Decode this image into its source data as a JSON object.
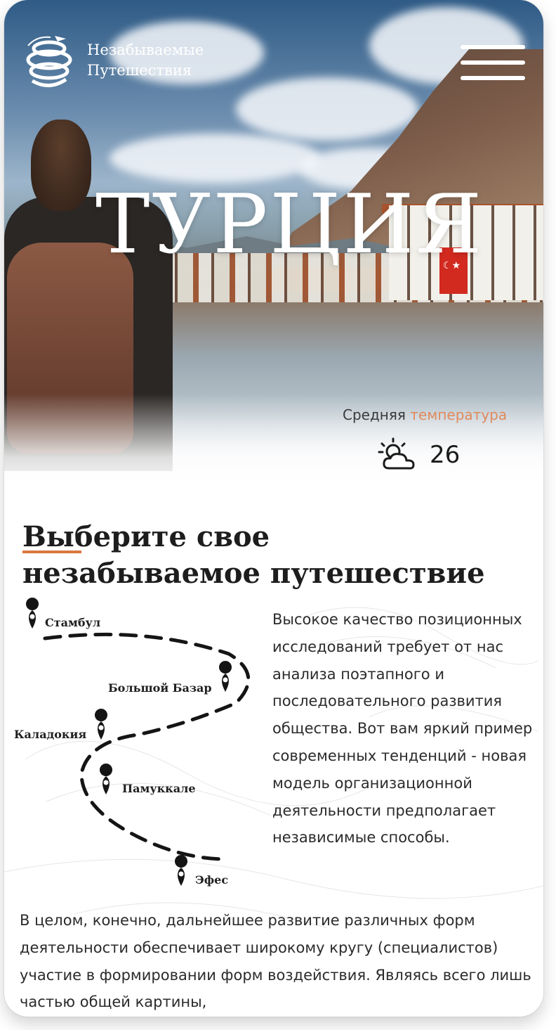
{
  "header": {
    "logo_line1": "Незабываемые",
    "logo_line2": "Путешествия",
    "logo_icon": "globe-plane-icon",
    "menu_icon": "hamburger-menu-icon"
  },
  "hero": {
    "country": "ТУРЦИЯ",
    "temperature_label_plain": "Средняя",
    "temperature_label_accent": "температура",
    "weather_icon": "partly-cloudy-icon",
    "temperature_value": "26"
  },
  "section": {
    "title_line1": "Выберите свое",
    "title_line2": "незабываемое путешествие"
  },
  "route": {
    "stops": [
      {
        "name": "Стамбул"
      },
      {
        "name": "Большой Базар"
      },
      {
        "name": "Каладокия"
      },
      {
        "name": "Памуккале"
      },
      {
        "name": "Эфес"
      }
    ]
  },
  "text": {
    "paragraph1": "Высокое качество позиционных исследований требует от нас анализа поэтапного и последовательного развития общества. Вот вам яркий пример современных тенденций - новая модель организационной деятельности предполагает независимые способы.",
    "paragraph2": "В целом, конечно, дальнейшее развитие различных форм деятельности обеспечивает широкому кругу (специалистов) участие в формировании форм воздействия. Являясь всего лишь частью общей картины,"
  },
  "colors": {
    "accent": "#d9783f",
    "text": "#1d1d1d",
    "white": "#ffffff"
  }
}
